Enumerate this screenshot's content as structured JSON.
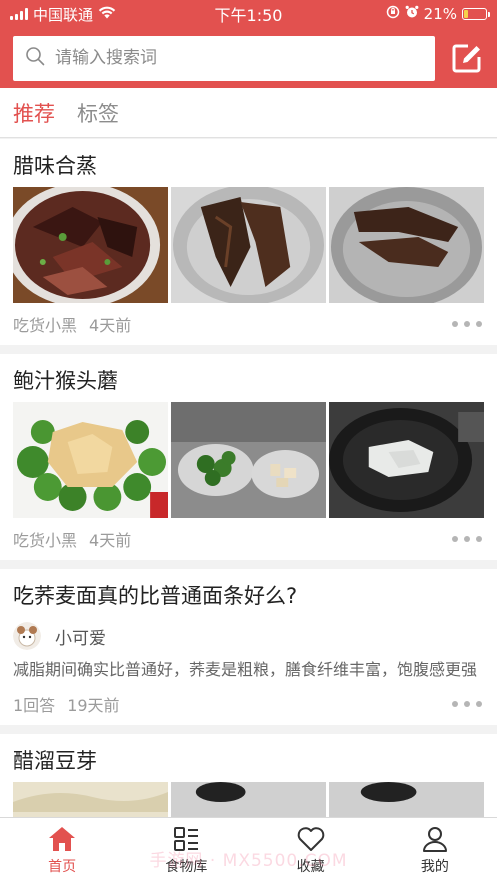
{
  "status_bar": {
    "carrier": "中国联通",
    "time": "下午1:50",
    "battery_percent": "21%",
    "battery_level": 0.21
  },
  "search": {
    "placeholder": "请输入搜索词"
  },
  "tabs": [
    {
      "label": "推荐",
      "active": true
    },
    {
      "label": "标签",
      "active": false
    }
  ],
  "feed": {
    "recipe1": {
      "title": "腊味合蒸",
      "author": "吃货小黑",
      "time": "4天前"
    },
    "recipe2": {
      "title": "鲍汁猴头蘑",
      "author": "吃货小黑",
      "time": "4天前"
    },
    "question": {
      "title": "吃荞麦面真的比普通面条好么?",
      "author": "小可爱",
      "content": "减脂期间确实比普通好，荞麦是粗粮，膳食纤维丰富，饱腹感更强",
      "answers": "1回答",
      "time": "19天前"
    },
    "recipe3": {
      "title": "醋溜豆芽"
    }
  },
  "bottom_nav": [
    {
      "label": "首页",
      "icon": "home-icon",
      "active": true
    },
    {
      "label": "食物库",
      "icon": "food-library-icon",
      "active": false
    },
    {
      "label": "收藏",
      "icon": "heart-icon",
      "active": false
    },
    {
      "label": "我的",
      "icon": "person-icon",
      "active": false
    }
  ],
  "watermark": "手游网 · MX5500.COM",
  "colors": {
    "accent": "#e2514f",
    "battery": "#f6d24b"
  }
}
